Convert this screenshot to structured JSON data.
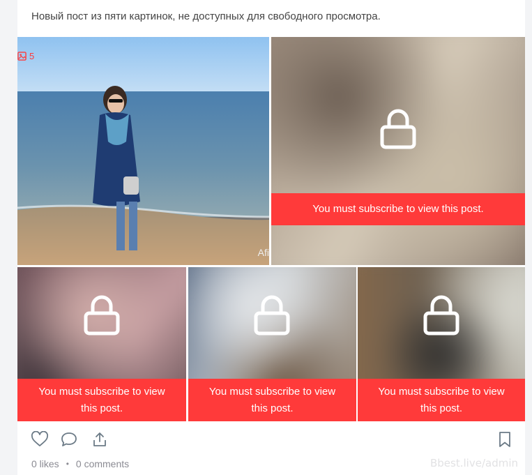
{
  "post": {
    "text": "Новый пост из пяти картинок, не доступных для свободного просмотра.",
    "image_count": "5",
    "lock_message": "You must subscribe to view this post."
  },
  "photo_watermark": "Afi",
  "stats": {
    "likes": "0 likes",
    "separator": "•",
    "comments": "0 comments"
  },
  "watermark": "Bbest.live/admin",
  "colors": {
    "accent": "#ff3a3a",
    "muted": "#8b8b93",
    "icon": "#6b7a86"
  },
  "icons": [
    "image-icon",
    "lock-icon",
    "heart-icon",
    "comment-icon",
    "share-icon",
    "bookmark-icon"
  ]
}
